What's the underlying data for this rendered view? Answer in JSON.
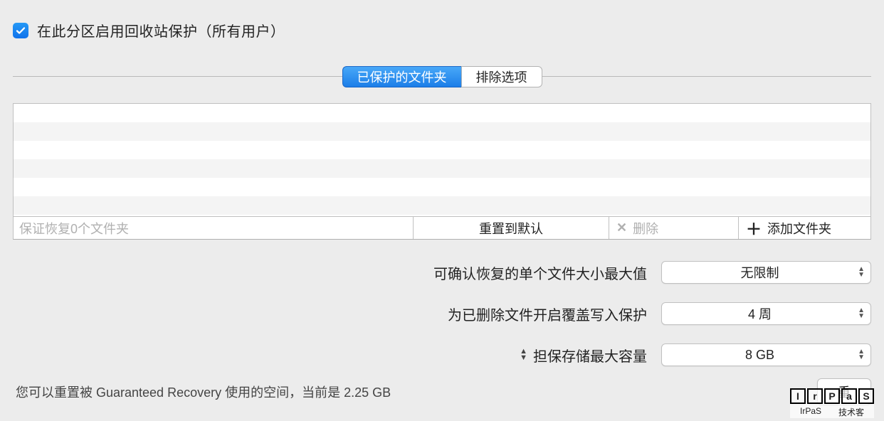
{
  "enable_checkbox": {
    "checked": true,
    "label": "在此分区启用回收站保护（所有用户）"
  },
  "tabs": {
    "protected": "已保护的文件夹",
    "exclude": "排除选项"
  },
  "list_toolbar": {
    "status": "保证恢复0个文件夹",
    "reset": "重置到默认",
    "delete": "删除",
    "add": "添加文件夹"
  },
  "settings": {
    "max_file_size": {
      "label": "可确认恢复的单个文件大小最大值",
      "value": "无限制"
    },
    "overwrite_protect": {
      "label": "为已删除文件开启覆盖写入保护",
      "value": "4 周"
    },
    "max_storage": {
      "label": "担保存储最大容量",
      "value": "8 GB"
    }
  },
  "footer": {
    "text": "您可以重置被 Guaranteed Recovery 使用的空间，当前是 2.25 GB",
    "button": "重"
  },
  "watermark": {
    "letters": [
      "I",
      "r",
      "P",
      "a",
      "S"
    ],
    "left_label": "IrPaS",
    "right_label": "技术客"
  }
}
